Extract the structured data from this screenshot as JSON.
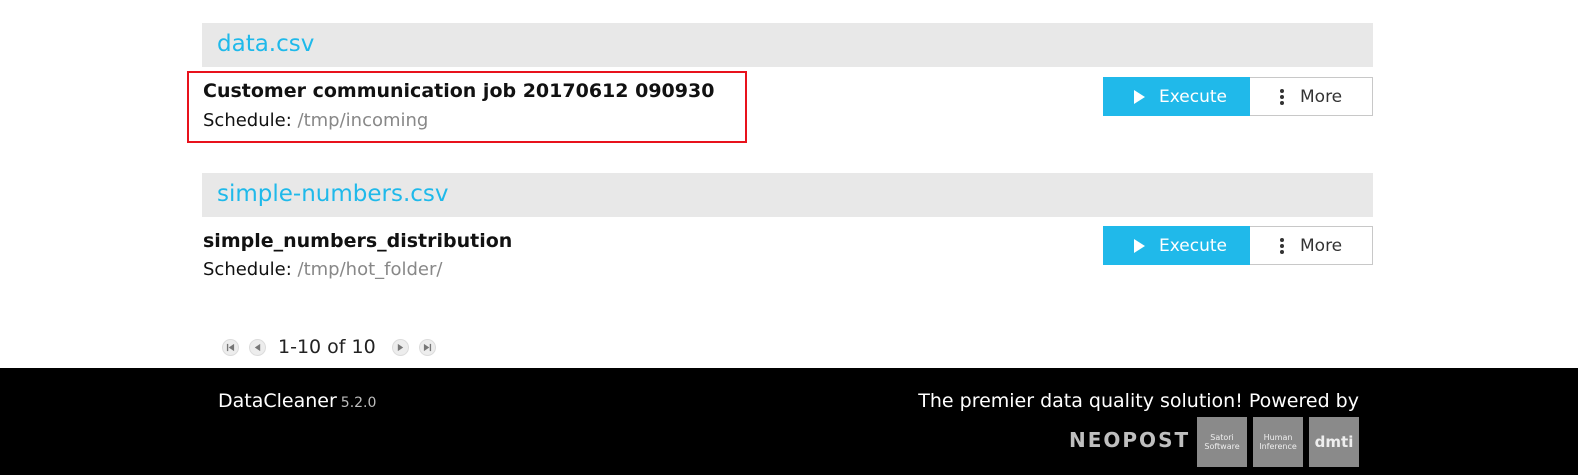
{
  "groups": [
    {
      "title": "data.csv",
      "job": {
        "name": "Customer communication job 20170612 090930",
        "schedule_label": "Schedule:",
        "schedule_path": "/tmp/incoming"
      }
    },
    {
      "title": "simple-numbers.csv",
      "job": {
        "name": "simple_numbers_distribution",
        "schedule_label": "Schedule:",
        "schedule_path": "/tmp/hot_folder/"
      }
    }
  ],
  "actions": {
    "execute_label": "Execute",
    "more_label": "More"
  },
  "pagination": {
    "range": "1-10 of 10"
  },
  "footer": {
    "app_name": "DataCleaner",
    "version": "5.2.0",
    "tagline": "The premier data quality solution! Powered by",
    "partner_wordmark": "NEOPOST",
    "partner_logos": [
      "Satori Software",
      "Human Inference",
      "dmti"
    ]
  },
  "colors": {
    "accent": "#20b9ea",
    "highlight": "#e8121c",
    "footer_bg": "#000000"
  }
}
